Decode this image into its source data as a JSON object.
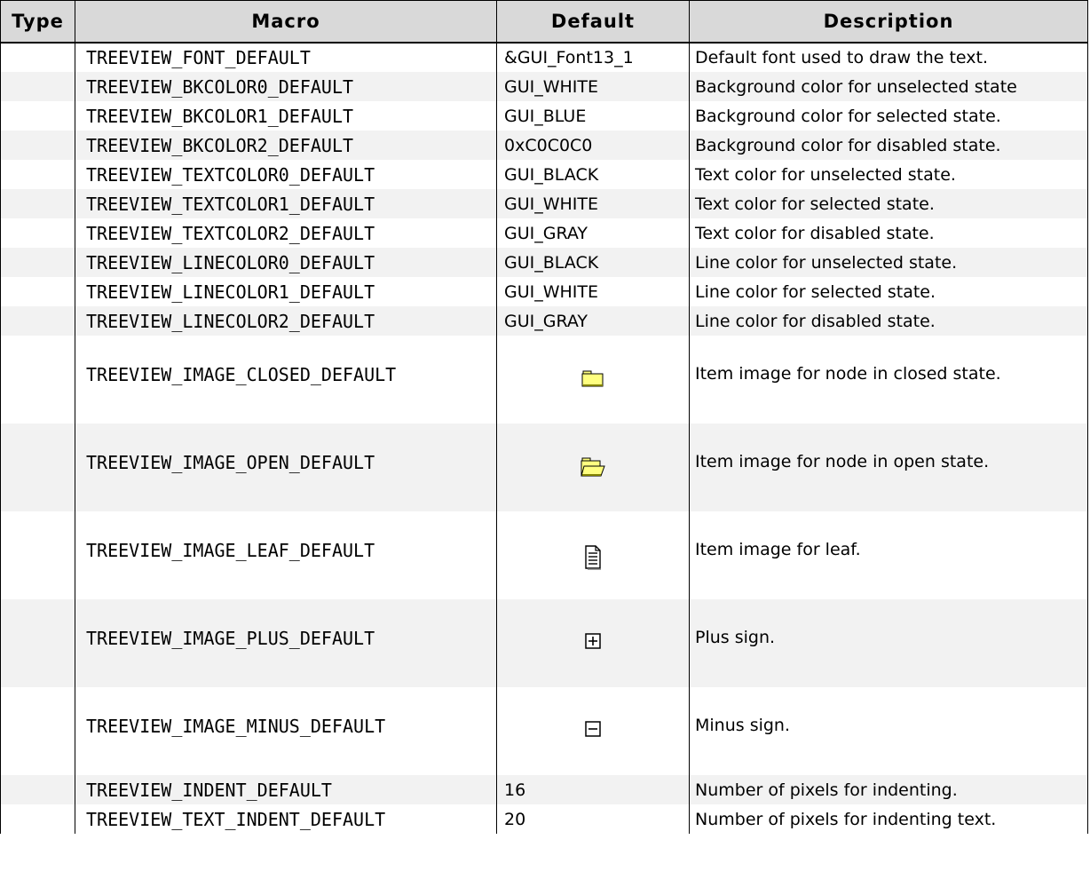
{
  "table": {
    "headers": {
      "type": "Type",
      "macro": "Macro",
      "default": "Default",
      "description": "Description"
    },
    "rows": [
      {
        "type": "",
        "macro": "TREEVIEW_FONT_DEFAULT",
        "default": "&GUI_Font13_1",
        "description": "Default font used to draw the text."
      },
      {
        "type": "",
        "macro": "TREEVIEW_BKCOLOR0_DEFAULT",
        "default": "GUI_WHITE",
        "description": "Background color for unselected state"
      },
      {
        "type": "",
        "macro": "TREEVIEW_BKCOLOR1_DEFAULT",
        "default": "GUI_BLUE",
        "description": "Background color for selected state."
      },
      {
        "type": "",
        "macro": "TREEVIEW_BKCOLOR2_DEFAULT",
        "default": "0xC0C0C0",
        "description": "Background color for disabled state."
      },
      {
        "type": "",
        "macro": "TREEVIEW_TEXTCOLOR0_DEFAULT",
        "default": "GUI_BLACK",
        "description": "Text color for unselected state."
      },
      {
        "type": "",
        "macro": "TREEVIEW_TEXTCOLOR1_DEFAULT",
        "default": "GUI_WHITE",
        "description": "Text color for selected state."
      },
      {
        "type": "",
        "macro": "TREEVIEW_TEXTCOLOR2_DEFAULT",
        "default": "GUI_GRAY",
        "description": "Text color for disabled state."
      },
      {
        "type": "",
        "macro": "TREEVIEW_LINECOLOR0_DEFAULT",
        "default": "GUI_BLACK",
        "description": "Line color for unselected state."
      },
      {
        "type": "",
        "macro": "TREEVIEW_LINECOLOR1_DEFAULT",
        "default": "GUI_WHITE",
        "description": "Line color for selected state."
      },
      {
        "type": "",
        "macro": "TREEVIEW_LINECOLOR2_DEFAULT",
        "default": "GUI_GRAY",
        "description": "Line color for disabled state."
      },
      {
        "type": "",
        "macro": "TREEVIEW_IMAGE_CLOSED_DEFAULT",
        "default_icon": "closed-folder-icon",
        "description": "Item image for node in closed state."
      },
      {
        "type": "",
        "macro": "TREEVIEW_IMAGE_OPEN_DEFAULT",
        "default_icon": "open-folder-icon",
        "description": "Item image for node in open state."
      },
      {
        "type": "",
        "macro": "TREEVIEW_IMAGE_LEAF_DEFAULT",
        "default_icon": "document-leaf-icon",
        "description": "Item image for leaf."
      },
      {
        "type": "",
        "macro": "TREEVIEW_IMAGE_PLUS_DEFAULT",
        "default_icon": "plus-box-icon",
        "description": "Plus sign."
      },
      {
        "type": "",
        "macro": "TREEVIEW_IMAGE_MINUS_DEFAULT",
        "default_icon": "minus-box-icon",
        "description": "Minus sign."
      },
      {
        "type": "",
        "macro": "TREEVIEW_INDENT_DEFAULT",
        "default": "16",
        "description": "Number of pixels for indenting."
      },
      {
        "type": "",
        "macro": "TREEVIEW_TEXT_INDENT_DEFAULT",
        "default": "20",
        "description": "Number of pixels for indenting text."
      }
    ]
  },
  "colors": {
    "header_bg": "#d9d9d9",
    "row_alt_bg": "#f2f2f2",
    "folder_yellow": "#ffff80"
  }
}
